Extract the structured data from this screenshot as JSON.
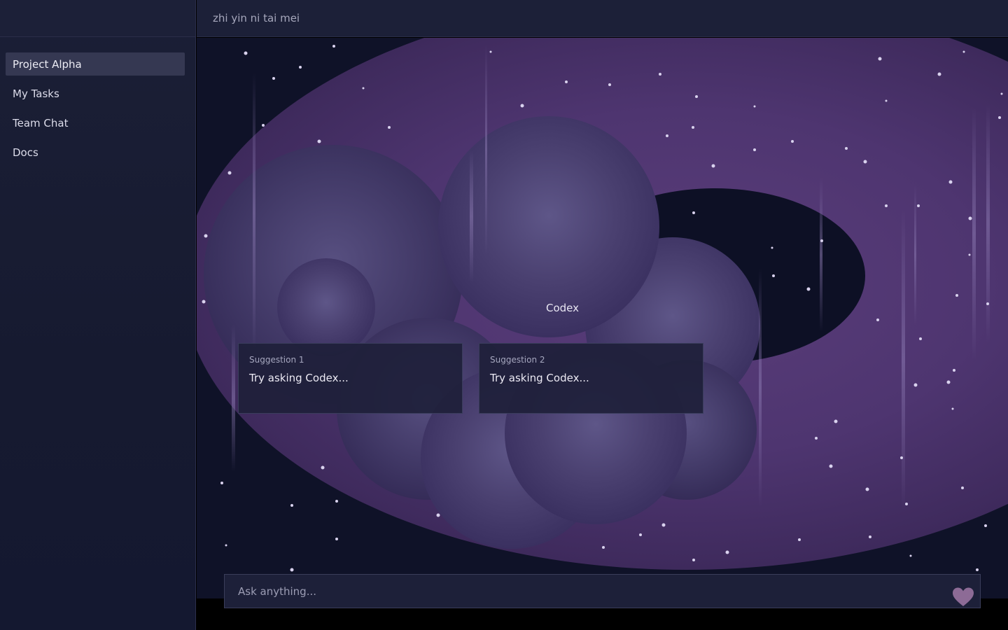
{
  "sidebar": {
    "items": [
      {
        "label": "Project Alpha",
        "active": true
      },
      {
        "label": "My Tasks",
        "active": false
      },
      {
        "label": "Team Chat",
        "active": false
      },
      {
        "label": "Docs",
        "active": false
      }
    ]
  },
  "header": {
    "title": "zhi yin ni tai mei"
  },
  "main": {
    "title": "Codex",
    "suggestions": [
      {
        "heading": "Suggestion 1",
        "text": "Try asking Codex..."
      },
      {
        "heading": "Suggestion 2",
        "text": "Try asking Codex..."
      }
    ]
  },
  "composer": {
    "placeholder": "Ask anything...",
    "send_icon": "heart-icon"
  },
  "colors": {
    "sidebar_bg": "#171b32",
    "header_bg": "#1c2038",
    "ring": "#4a3468",
    "orb": "#524a78",
    "card_bg": "#1e203a",
    "heart": "#8a6a94"
  }
}
